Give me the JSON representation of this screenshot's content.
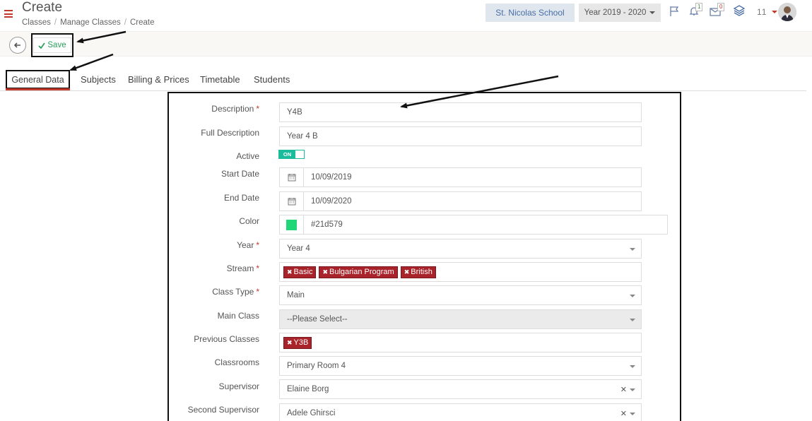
{
  "header": {
    "title": "Create",
    "breadcrumb": [
      "Classes",
      "Manage Classes",
      "Create"
    ],
    "school": "St. Nicolas School",
    "year": "Year 2019 - 2020",
    "notifications_count": "1",
    "messages_count": "0",
    "user_count": "11"
  },
  "toolbar": {
    "save_label": "Save"
  },
  "tabs": [
    "General Data",
    "Subjects",
    "Billing & Prices",
    "Timetable",
    "Students"
  ],
  "form": {
    "description": {
      "label": "Description",
      "value": "Y4B"
    },
    "full_description": {
      "label": "Full Description",
      "value": "Year 4 B"
    },
    "active": {
      "label": "Active",
      "value": "ON"
    },
    "start_date": {
      "label": "Start Date",
      "value": "10/09/2019"
    },
    "end_date": {
      "label": "End Date",
      "value": "10/09/2020"
    },
    "color": {
      "label": "Color",
      "value": "#21d579"
    },
    "year": {
      "label": "Year",
      "value": "Year 4"
    },
    "stream": {
      "label": "Stream",
      "tags": [
        "Basic",
        "Bulgarian Program",
        "British"
      ]
    },
    "class_type": {
      "label": "Class Type",
      "value": "Main"
    },
    "main_class": {
      "label": "Main Class",
      "value": "--Please Select--"
    },
    "previous_classes": {
      "label": "Previous Classes",
      "tags": [
        "Y3B"
      ]
    },
    "classrooms": {
      "label": "Classrooms",
      "value": "Primary Room 4"
    },
    "supervisor": {
      "label": "Supervisor",
      "value": "Elaine Borg"
    },
    "second_supervisor": {
      "label": "Second Supervisor",
      "value": "Adele Ghirsci"
    }
  },
  "colors": {
    "accent_red": "#c0392b",
    "tag_red": "#a8232a",
    "toggle_green": "#1abc9c",
    "save_green": "#2aa05c"
  }
}
